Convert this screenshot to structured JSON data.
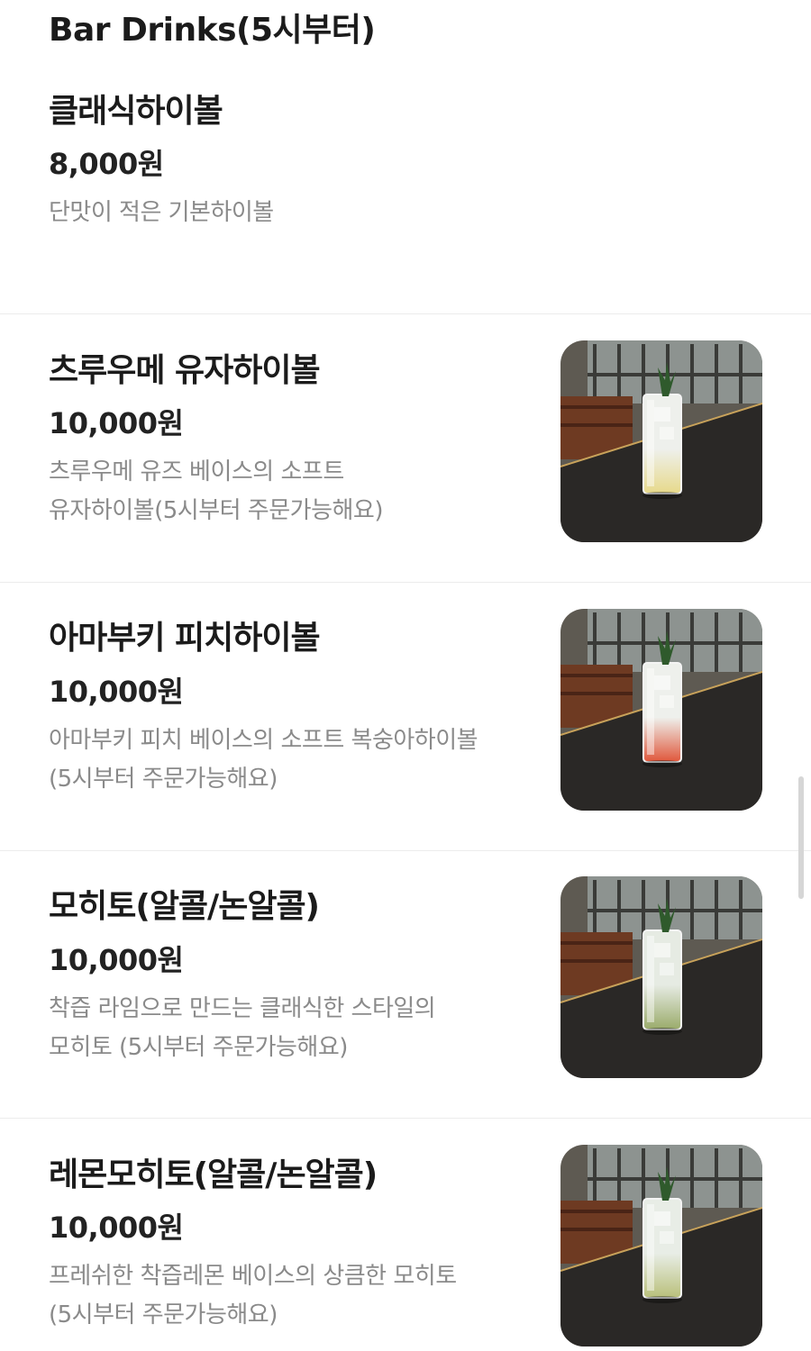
{
  "section": {
    "title": "Bar Drinks(5시부터)"
  },
  "items": [
    {
      "name": "클래식하이볼",
      "price": "8,000원",
      "desc_lines": [
        "단맛이 적은 기본하이볼"
      ],
      "has_image": false
    },
    {
      "name": "츠루우메 유자하이볼",
      "price": "10,000원",
      "desc_lines": [
        "츠루우메 유즈 베이스의 소프트",
        "유자하이볼(5시부터 주문가능해요)"
      ],
      "has_image": true,
      "drink_colors": {
        "top": "#eef0ec",
        "bottom": "#e7d98a"
      }
    },
    {
      "name": "아마부키 피치하이볼",
      "price": "10,000원",
      "desc_lines": [
        "아마부키 피치 베이스의 소프트 복숭아하이볼",
        "(5시부터 주문가능해요)"
      ],
      "has_image": true,
      "drink_colors": {
        "top": "#eef0ec",
        "bottom": "#e0563a"
      }
    },
    {
      "name": "모히토(알콜/논알콜)",
      "price": "10,000원",
      "desc_lines": [
        "착즙 라임으로 만드는 클래식한 스타일의",
        "모히토 (5시부터 주문가능해요)"
      ],
      "has_image": true,
      "drink_colors": {
        "top": "#e6ebe3",
        "bottom": "#9aab6a"
      }
    },
    {
      "name": "레몬모히토(알콜/논알콜)",
      "price": "10,000원",
      "desc_lines": [
        "프레쉬한 착즙레몬 베이스의 상큼한 모히토",
        "(5시부터 주문가능해요)"
      ],
      "has_image": true,
      "drink_colors": {
        "top": "#e8ede6",
        "bottom": "#b9c07a"
      }
    }
  ],
  "colors": {
    "text_primary": "#1b1b1b",
    "text_secondary": "#8a8a8a",
    "divider": "#ececec",
    "table_surface": "#2a2826"
  }
}
